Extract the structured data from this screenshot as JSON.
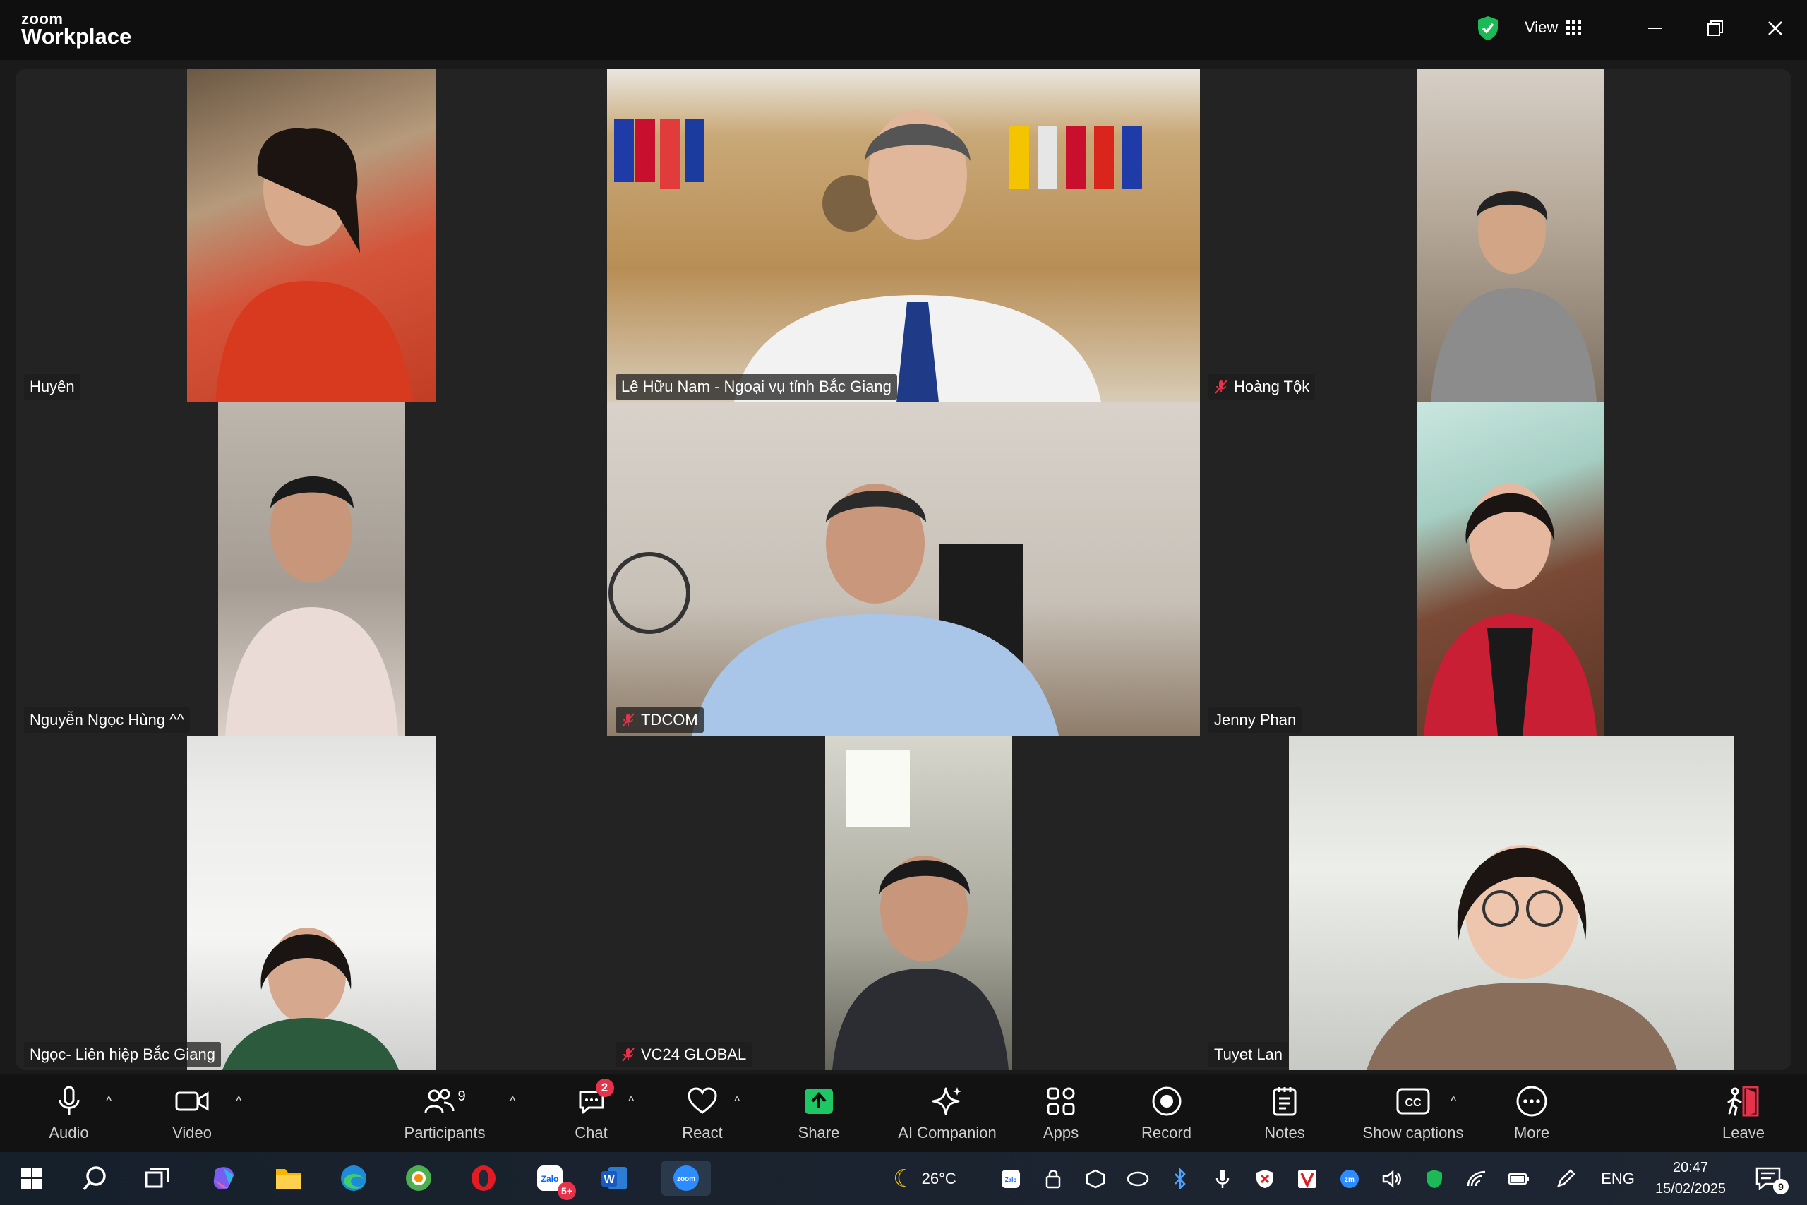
{
  "window": {
    "logo_small": "zoom",
    "logo_big": "Workplace",
    "view_label": "View"
  },
  "participants": [
    {
      "name": "Huyên",
      "muted": false
    },
    {
      "name": "Lê Hữu Nam - Ngoại vụ tỉnh Bắc Giang",
      "muted": false,
      "active_speaker": true
    },
    {
      "name": "Hoàng Tộk",
      "muted": true
    },
    {
      "name": "Nguyễn Ngọc Hùng ^^",
      "muted": false
    },
    {
      "name": "TDCOM",
      "muted": true
    },
    {
      "name": "Jenny Phan",
      "muted": false
    },
    {
      "name": "Ngọc- Liên hiệp Bắc Giang",
      "muted": false
    },
    {
      "name": "VC24 GLOBAL",
      "muted": true
    },
    {
      "name": "Tuyet Lan",
      "muted": false
    }
  ],
  "toolbar": {
    "audio": "Audio",
    "video": "Video",
    "participants": "Participants",
    "participants_count": "9",
    "chat": "Chat",
    "chat_badge": "2",
    "react": "React",
    "share": "Share",
    "ai_companion": "AI Companion",
    "apps": "Apps",
    "record": "Record",
    "notes": "Notes",
    "show_captions": "Show captions",
    "more": "More",
    "leave": "Leave"
  },
  "taskbar": {
    "weather": "26°C",
    "language": "ENG",
    "time": "20:47",
    "date": "15/02/2025",
    "zalo_badge": "5+",
    "notification_count": "9"
  },
  "colors": {
    "active_speaker": "#39d27a",
    "share": "#1fc764",
    "badge": "#e4334a",
    "shield": "#1db954"
  }
}
